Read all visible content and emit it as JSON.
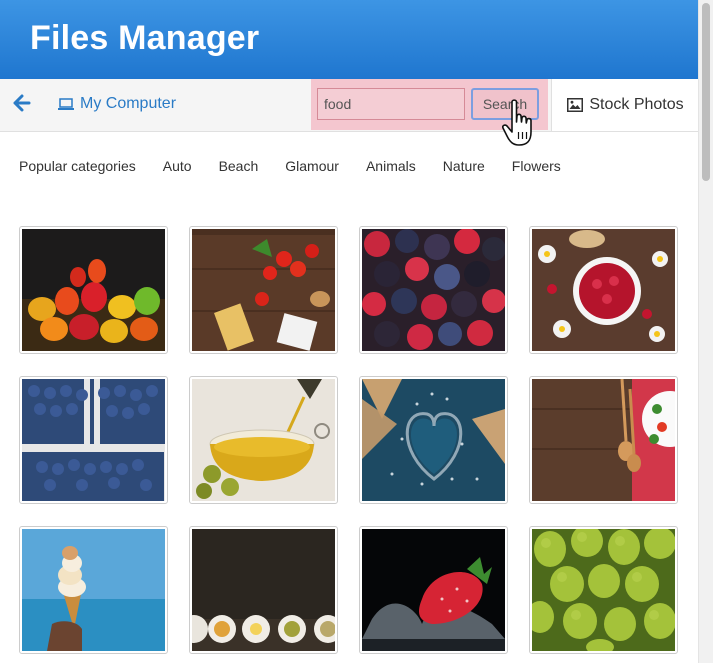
{
  "app": {
    "title": "Files Manager",
    "brand_color": "#2a84da"
  },
  "toolbar": {
    "back_icon": "arrow-left-icon",
    "my_computer_label": "My Computer",
    "my_computer_icon": "laptop-icon",
    "search": {
      "value": "food",
      "button_label": "Search"
    },
    "stock_photos_label": "Stock Photos",
    "stock_photos_icon": "image-icon"
  },
  "categories": {
    "heading": "Popular categories",
    "items": [
      "Auto",
      "Beach",
      "Glamour",
      "Animals",
      "Nature",
      "Flowers"
    ]
  },
  "photos": [
    {
      "subject": "gummy-bears"
    },
    {
      "subject": "pasta-tomatoes"
    },
    {
      "subject": "berries"
    },
    {
      "subject": "raspberries-bowl"
    },
    {
      "subject": "blueberries"
    },
    {
      "subject": "olive-oil"
    },
    {
      "subject": "sugar-heart-waffles"
    },
    {
      "subject": "wooden-spoons-salad"
    },
    {
      "subject": "ice-cream-cone"
    },
    {
      "subject": "plates-dark-table"
    },
    {
      "subject": "strawberry-splash"
    },
    {
      "subject": "pears"
    }
  ]
}
